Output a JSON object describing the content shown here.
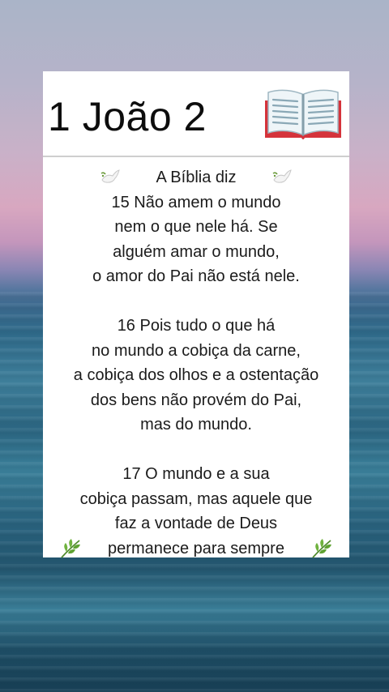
{
  "card": {
    "title": "1 João 2",
    "header": "A Bíblia diz",
    "lines": [
      "15 Não amem o mundo",
      "nem o que nele há. Se",
      "alguém amar o mundo,",
      "o amor do Pai não está nele.",
      "",
      "16 Pois tudo o que há",
      "no mundo a cobiça da carne,",
      "a cobiça dos olhos e a ostentação",
      "dos bens não provém do Pai,",
      "mas do mundo.",
      "",
      "17 O mundo e a sua",
      "cobiça passam, mas aquele que",
      "faz a vontade de Deus",
      "permanece para sempre"
    ]
  },
  "icons": {
    "title_icon": "open-book-icon",
    "header_icons": [
      "dove-icon",
      "dove-icon"
    ],
    "footer_icons": [
      "herb-icon",
      "herb-icon"
    ]
  },
  "colors": {
    "card_background": "#ffffff",
    "text": "#1b1b1b",
    "book_cover": "#d5333b"
  }
}
